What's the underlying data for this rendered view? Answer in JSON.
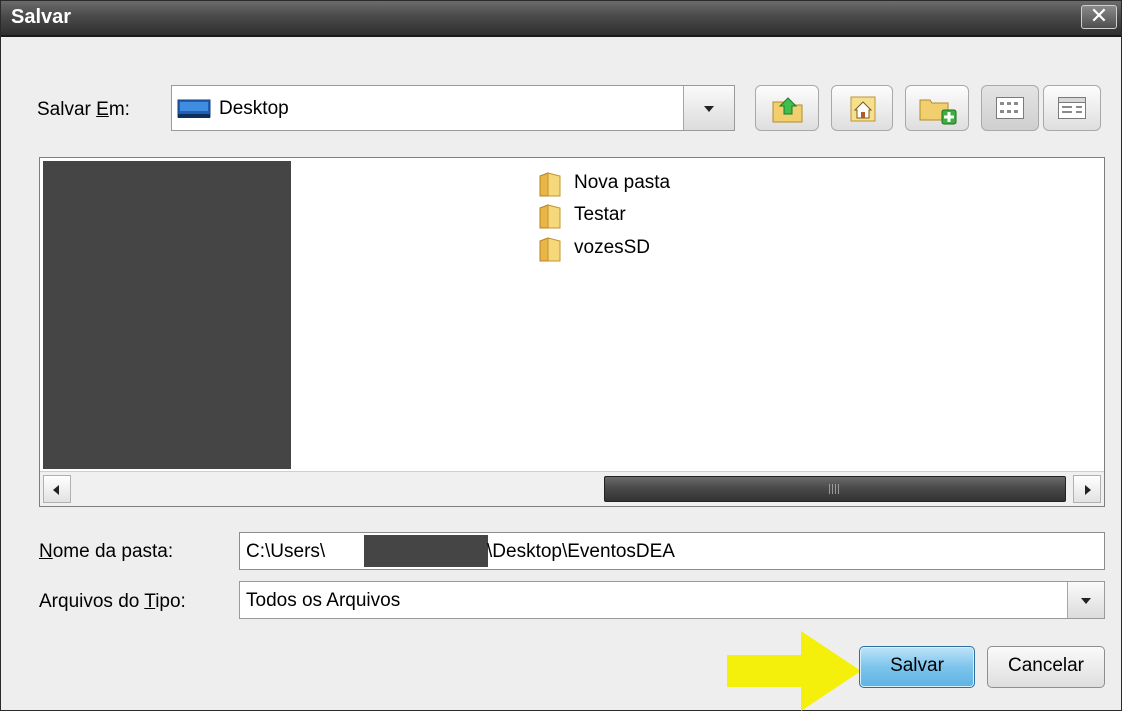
{
  "window": {
    "title": "Salvar",
    "close_glyph": "✕"
  },
  "location": {
    "label_prefix": "Salvar ",
    "label_mnemonic": "E",
    "label_suffix": "m:",
    "value": "Desktop",
    "value_icon": "desktop-icon"
  },
  "toolbar": {
    "buttons": [
      {
        "name": "up-one-level",
        "icon": "folder-up-icon"
      },
      {
        "name": "home",
        "icon": "home-icon"
      },
      {
        "name": "new-folder",
        "icon": "new-folder-icon"
      },
      {
        "name": "list-view",
        "icon": "list-view-icon",
        "selected": true
      },
      {
        "name": "details-view",
        "icon": "details-view-icon",
        "selected": false
      }
    ]
  },
  "files": [
    {
      "label": "Nova pasta",
      "icon": "folder-icon"
    },
    {
      "label": "Testar",
      "icon": "folder-icon"
    },
    {
      "label": "vozesSD",
      "icon": "folder-icon"
    }
  ],
  "folder_name": {
    "label_mnemonic": "N",
    "label_suffix": "ome da pasta:",
    "value_prefix": "C:\\Users\\",
    "value_suffix": "\\Desktop\\EventosDEA"
  },
  "file_type": {
    "label_prefix": "Arquivos do ",
    "label_mnemonic": "T",
    "label_suffix": "ipo:",
    "value": "Todos os Arquivos"
  },
  "buttons": {
    "save": "Salvar",
    "cancel": "Cancelar"
  },
  "colors": {
    "annotation_arrow": "#f5ef0c",
    "title_bar": "#3b3b3b",
    "primary_button": "#7cc4ec"
  }
}
